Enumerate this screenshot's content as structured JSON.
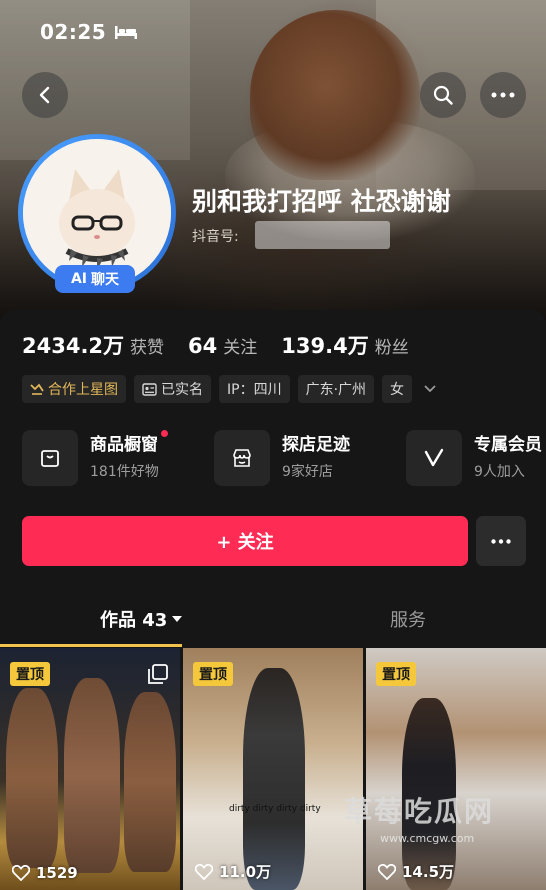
{
  "status_bar": {
    "time": "02:25",
    "bed_icon": "bed-icon"
  },
  "header": {
    "nickname": "别和我打招呼 社恐谢谢",
    "douyin_id_label": "抖音号:",
    "ai_badge": {
      "prefix": "AI",
      "label": "聊天"
    }
  },
  "stats": [
    {
      "num": "2434.2万",
      "label": "获赞"
    },
    {
      "num": "64",
      "label": "关注"
    },
    {
      "num": "139.4万",
      "label": "粉丝"
    }
  ],
  "tags": [
    {
      "label": "合作上星图",
      "icon": "star-map-icon",
      "highlight": true
    },
    {
      "label": "已实名",
      "icon": "id-card-icon"
    },
    {
      "label": "IP：四川"
    },
    {
      "label": "广东·广州"
    },
    {
      "label": "女"
    }
  ],
  "services": [
    {
      "title": "商品橱窗",
      "sub": "181件好物",
      "icon": "shopping-bag-icon",
      "has_dot": true
    },
    {
      "title": "探店足迹",
      "sub": "9家好店",
      "icon": "shop-icon"
    },
    {
      "title": "专属会员",
      "sub": "9人加入",
      "icon": "v-icon"
    }
  ],
  "actions": {
    "follow_label": "+ 关注"
  },
  "tabs": [
    {
      "label": "作品 43",
      "active": true
    },
    {
      "label": "服务",
      "active": false
    }
  ],
  "videos": [
    {
      "pinned_label": "置顶",
      "likes": "1529",
      "multi_image": true
    },
    {
      "pinned_label": "置顶",
      "likes": "11.0万",
      "caption": "dirty dirty dirty dirty"
    },
    {
      "pinned_label": "置顶",
      "likes": "14.5万"
    }
  ],
  "watermark": {
    "text": "草莓吃瓜网",
    "url": "www.cmcgw.com"
  },
  "colors": {
    "accent": "#fe2c55",
    "pin": "#f4c83a",
    "ai_badge": "#3d7bf0",
    "gold_tag": "#e2b75a"
  }
}
